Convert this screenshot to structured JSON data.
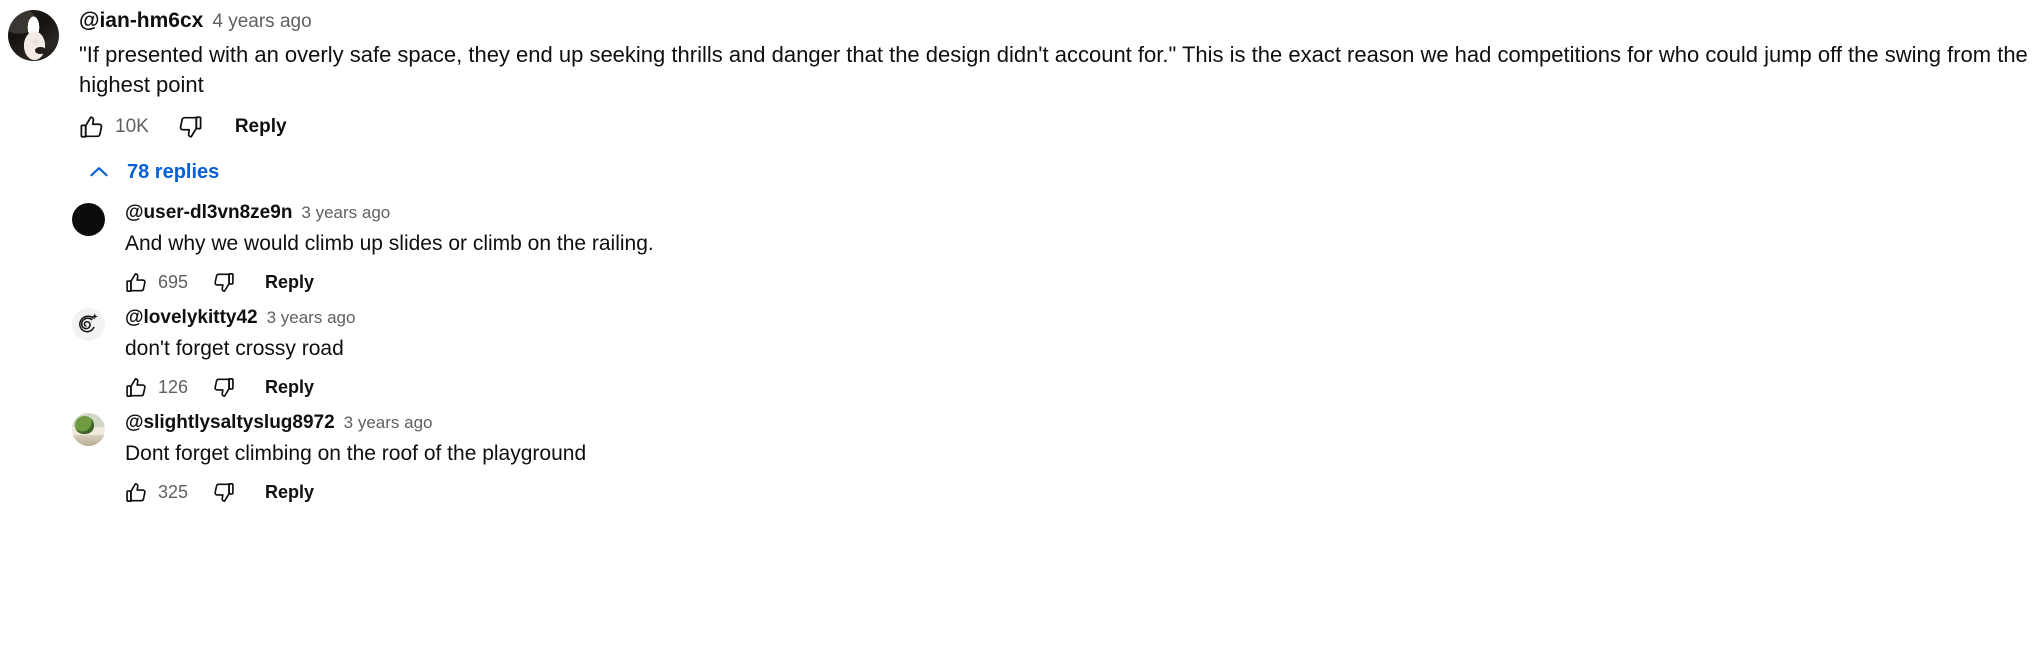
{
  "colors": {
    "link_blue": "#065fd4",
    "text_primary": "#0f0f0f",
    "text_secondary": "#606060",
    "background": "#ffffff"
  },
  "top_comment": {
    "author": "@ian-hm6cx",
    "timestamp": "4 years ago",
    "text": "\"If presented with an overly safe space, they end up seeking thrills and danger that the design didn't account for.\" This is the exact reason we had competitions for who could jump off the swing from the highest point",
    "like_count": "10K",
    "reply_label": "Reply",
    "avatar_kind": "dog-photo-avatar",
    "like_icon": "thumbs-up-icon",
    "dislike_icon": "thumbs-down-icon"
  },
  "replies_toggle": {
    "label": "78 replies",
    "icon": "chevron-up-icon",
    "expanded": true
  },
  "replies": [
    {
      "author": "@user-dl3vn8ze9n",
      "timestamp": "3 years ago",
      "text": "And why we would climb up slides or climb on the railing.",
      "like_count": "695",
      "reply_label": "Reply",
      "avatar_kind": "black-circle-avatar",
      "like_icon": "thumbs-up-icon",
      "dislike_icon": "thumbs-down-icon"
    },
    {
      "author": "@lovelykitty42",
      "timestamp": "3 years ago",
      "text": "don't forget crossy road",
      "like_count": "126",
      "reply_label": "Reply",
      "avatar_kind": "swirl-avatar",
      "like_icon": "thumbs-up-icon",
      "dislike_icon": "thumbs-down-icon"
    },
    {
      "author": "@slightlysaltyslug8972",
      "timestamp": "3 years ago",
      "text": "Dont forget climbing on the roof of the playground",
      "like_count": "325",
      "reply_label": "Reply",
      "avatar_kind": "scene-avatar",
      "like_icon": "thumbs-up-icon",
      "dislike_icon": "thumbs-down-icon"
    }
  ]
}
